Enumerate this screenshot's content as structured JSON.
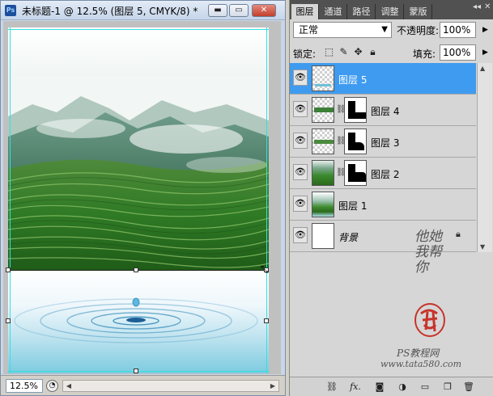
{
  "document": {
    "app_badge": "Ps",
    "title": "未标题-1 @ 12.5% (图层 5, CMYK/8) *",
    "buttons": {
      "minimize": "▬",
      "maximize": "▭",
      "close": "✕"
    },
    "zoom": "12.5%"
  },
  "panel": {
    "tabs": [
      "图层",
      "通道",
      "路径",
      "调整",
      "蒙版"
    ],
    "active_tab": "图层",
    "blend_mode": "正常",
    "opacity_label": "不透明度:",
    "opacity_value": "100%",
    "lock_label": "锁定:",
    "fill_label": "填充:",
    "fill_value": "100%",
    "layers": [
      {
        "name": "图层 5",
        "selected": true,
        "has_mask": false,
        "thumb": "transparent"
      },
      {
        "name": "图层 4",
        "selected": false,
        "has_mask": true,
        "thumb": "transparent-with-strip"
      },
      {
        "name": "图层 3",
        "selected": false,
        "has_mask": true,
        "thumb": "transparent-with-strip"
      },
      {
        "name": "图层 2",
        "selected": false,
        "has_mask": true,
        "thumb": "landscape-strip"
      },
      {
        "name": "图层 1",
        "selected": false,
        "has_mask": false,
        "thumb": "landscape"
      },
      {
        "name": "背景",
        "selected": false,
        "has_mask": false,
        "thumb": "white",
        "locked": true
      }
    ],
    "watermark": {
      "vertical_text": "他她我帮你",
      "line1": "PS教程网",
      "line2": "www.tata580.com"
    }
  },
  "icons": {
    "eye": "eye-icon",
    "link": "link-icon",
    "fx": "fx-icon",
    "mask": "add-mask-icon",
    "adjust": "adjustment-icon",
    "group": "folder-icon",
    "new": "new-layer-icon",
    "delete": "trash-icon"
  },
  "colors": {
    "selection": "#3e9bef",
    "guides": "#33e0e0",
    "tab_bar": "#515151"
  }
}
